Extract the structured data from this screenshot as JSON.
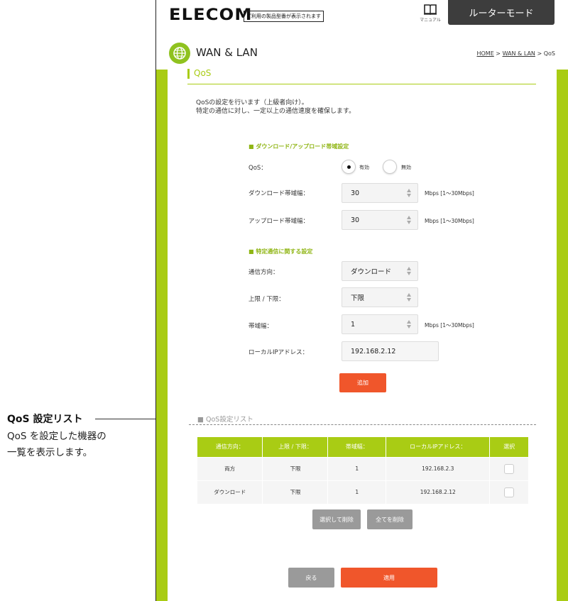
{
  "annotation": {
    "title": "QoS 設定リスト",
    "desc_line1": "QoS を設定した機器の",
    "desc_line2": "一覧を表示します。"
  },
  "header": {
    "logo": "ELECOM",
    "tagline": "ご利用の製品型番が表示されます",
    "manual_label": "マニュアル",
    "mode_button": "ルーターモード"
  },
  "page": {
    "title": "WAN & LAN",
    "breadcrumb": {
      "home": "HOME",
      "sep1": " > ",
      "wan": "WAN & LAN",
      "sep2": " > ",
      "current": "QoS"
    },
    "section_title": "QoS",
    "description_line1": "QoSの設定を行います（上級者向け）。",
    "description_line2": "特定の通信に対し、一定以上の通信速度を確保します。"
  },
  "bandwidth": {
    "group_title": "■ ダウンロード/アップロード帯域設定",
    "qos_label": "QoS：",
    "qos_on": "有効",
    "qos_off": "無効",
    "qos_enabled": true,
    "download_label": "ダウンロード帯域幅：",
    "download_value": "30",
    "download_unit": "Mbps [1～30Mbps]",
    "upload_label": "アップロード帯域幅：",
    "upload_value": "30",
    "upload_unit": "Mbps [1～30Mbps]"
  },
  "specific": {
    "group_title": "■ 特定通信に関する設定",
    "direction_label": "通信方向：",
    "direction_value": "ダウンロード",
    "limit_label": "上限 / 下限：",
    "limit_value": "下限",
    "bw_label": "帯域幅：",
    "bw_value": "1",
    "bw_unit": "Mbps [1～30Mbps]",
    "ip_label": "ローカルIPアドレス：",
    "ip_value": "192.168.2.12",
    "add_button": "追加"
  },
  "list": {
    "title": "■ QoS設定リスト",
    "headers": [
      "通信方向：",
      "上限 / 下限：",
      "帯域幅：",
      "ローカルIPアドレス：",
      "選択"
    ],
    "rows": [
      [
        "両方",
        "下限",
        "1",
        "192.168.2.3"
      ],
      [
        "ダウンロード",
        "下限",
        "1",
        "192.168.2.12"
      ]
    ],
    "delete_selected": "選択して削除",
    "delete_all": "全てを削除"
  },
  "footer": {
    "back": "戻る",
    "apply": "適用"
  },
  "colors": {
    "accent_green": "#a9cc14",
    "button_orange": "#f0562b",
    "button_gray": "#9a9a9a",
    "mode_dark": "#3d3d3d"
  }
}
